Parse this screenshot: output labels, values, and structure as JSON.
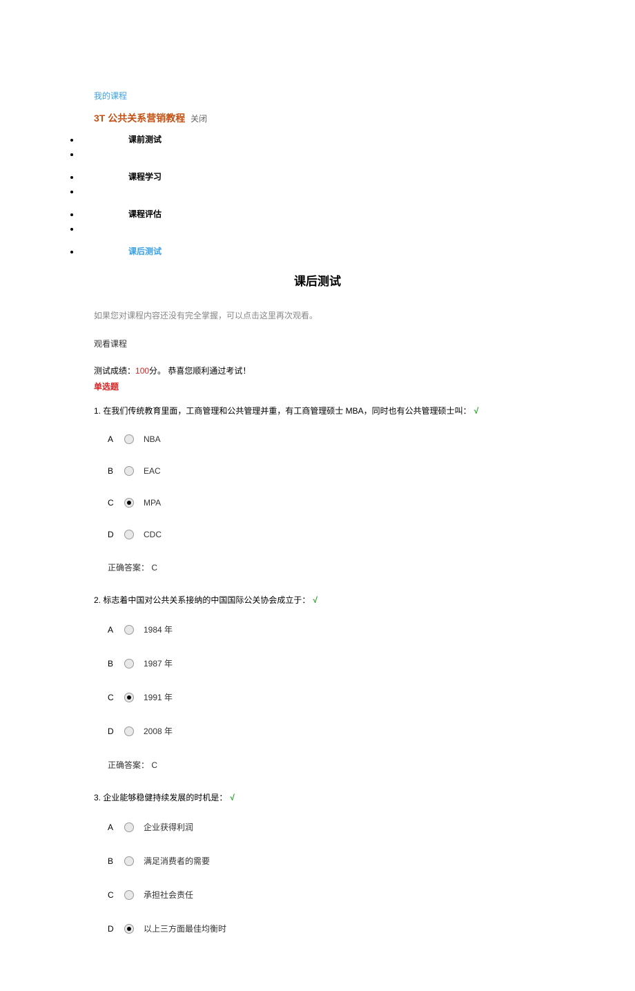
{
  "breadcrumb": "我的课程",
  "course": {
    "title": "3T 公共关系营销教程",
    "close_label": "关闭"
  },
  "nav": {
    "items": [
      {
        "label": "课前测试"
      },
      {
        "label": "课程学习"
      },
      {
        "label": "课程评估"
      },
      {
        "label": "课后测试",
        "active": true
      }
    ]
  },
  "page_title": "课后测试",
  "review_note": "如果您对课程内容还没有完全掌握，可以点击这里再次观看。",
  "watch_course": "观看课程",
  "score": {
    "prefix": "测试成绩：",
    "value": "100",
    "unit": "分。",
    "congrats": "  恭喜您顺利通过考试！"
  },
  "single_choice_label": "单选题",
  "correct_answer_label": "正确答案：",
  "questions": [
    {
      "number": "1.",
      "text": "在我们传统教育里面，工商管理和公共管理并重，有工商管理硕士 MBA，同时也有公共管理硕士叫：",
      "correct": true,
      "options": [
        {
          "letter": "A",
          "text": "NBA",
          "selected": false
        },
        {
          "letter": "B",
          "text": "EAC",
          "selected": false
        },
        {
          "letter": "C",
          "text": "MPA",
          "selected": true
        },
        {
          "letter": "D",
          "text": "CDC",
          "selected": false
        }
      ],
      "correct_answer": "C"
    },
    {
      "number": "2.",
      "text": "标志着中国对公共关系接纳的中国国际公关协会成立于：",
      "correct": true,
      "options": [
        {
          "letter": "A",
          "text": "1984 年",
          "selected": false
        },
        {
          "letter": "B",
          "text": "1987 年",
          "selected": false
        },
        {
          "letter": "C",
          "text": "1991 年",
          "selected": true
        },
        {
          "letter": "D",
          "text": "2008 年",
          "selected": false
        }
      ],
      "correct_answer": "C"
    },
    {
      "number": "3.",
      "text": "企业能够稳健持续发展的时机是：",
      "correct": true,
      "options": [
        {
          "letter": "A",
          "text": "企业获得利润",
          "selected": false
        },
        {
          "letter": "B",
          "text": "满足消费者的需要",
          "selected": false
        },
        {
          "letter": "C",
          "text": "承担社会责任",
          "selected": false
        },
        {
          "letter": "D",
          "text": "以上三方面最佳均衡时",
          "selected": true
        }
      ],
      "correct_answer": ""
    }
  ]
}
